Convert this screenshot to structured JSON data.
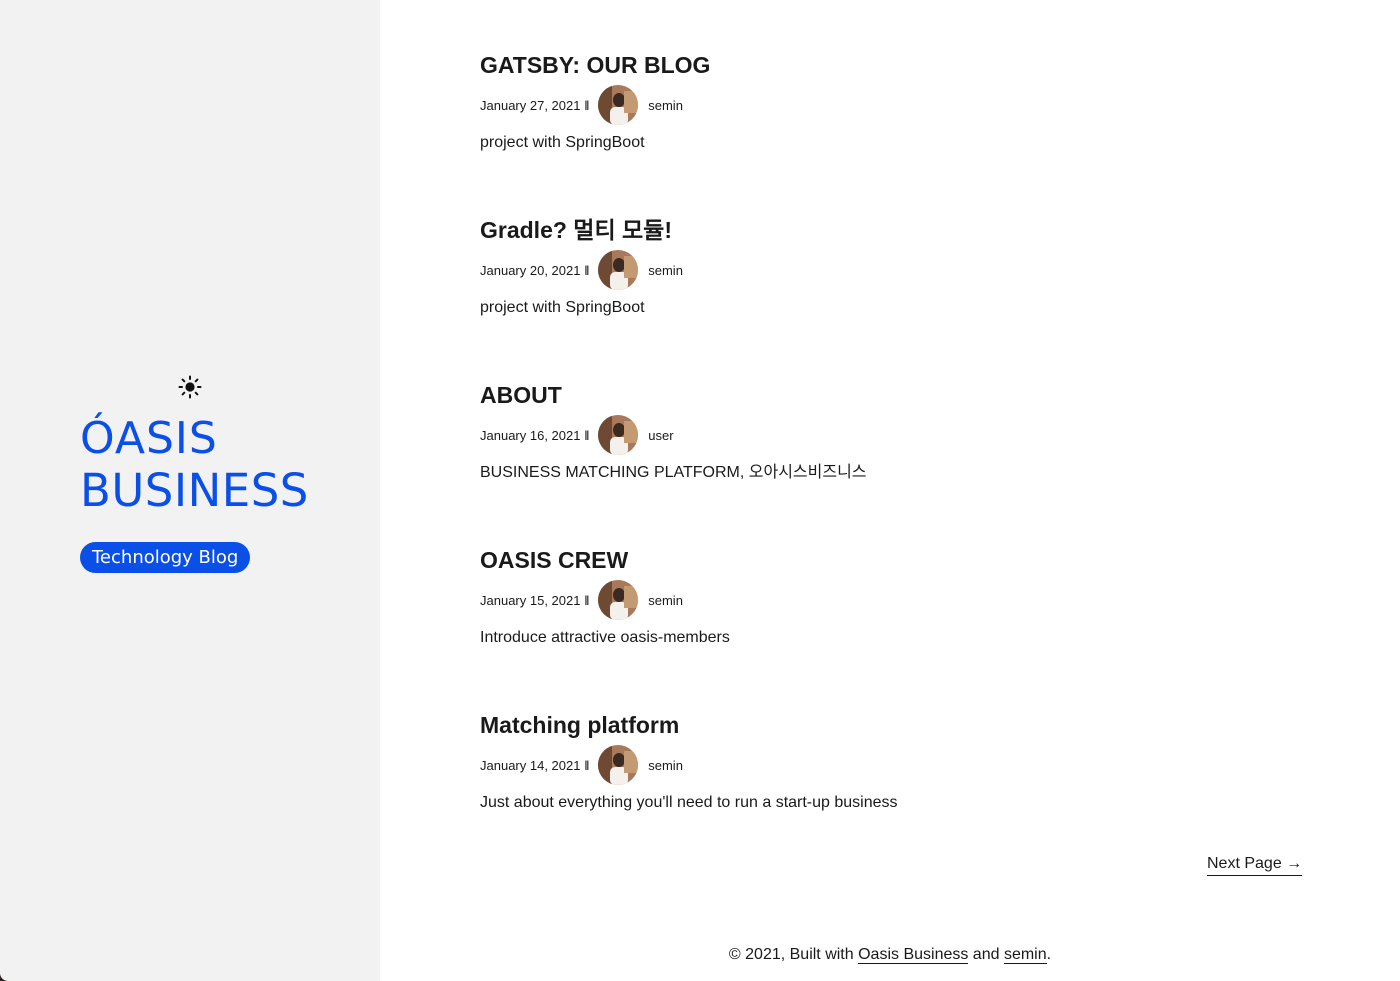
{
  "sidebar": {
    "theme_icon": "sun-icon",
    "logo": {
      "line1": "ÓASIS",
      "line2": "BUSINESS"
    },
    "badge": "Technology Blog",
    "brand_color": "#0a4fe8"
  },
  "posts": [
    {
      "title": "GATSBY: OUR BLOG",
      "date": "January 27, 2021",
      "separator": "ll",
      "author": "semin",
      "description": "project with SpringBoot"
    },
    {
      "title": "Gradle? 멀티 모듈!",
      "date": "January 20, 2021",
      "separator": "ll",
      "author": "semin",
      "description": "project with SpringBoot"
    },
    {
      "title": "ABOUT",
      "date": "January 16, 2021",
      "separator": "ll",
      "author": "user",
      "description": "BUSINESS MATCHING PLATFORM, 오아시스비즈니스"
    },
    {
      "title": "OASIS CREW",
      "date": "January 15, 2021",
      "separator": "ll",
      "author": "semin",
      "description": "Introduce attractive oasis-members"
    },
    {
      "title": "Matching platform",
      "date": "January 14, 2021",
      "separator": "ll",
      "author": "semin",
      "description": "Just about everything you'll need to run a start-up business"
    }
  ],
  "pagination": {
    "next_label": "Next Page →"
  },
  "footer": {
    "prefix": "© 2021, Built with ",
    "link1": "Oasis Business",
    "middle": " and ",
    "link2": "semin",
    "suffix": "."
  }
}
